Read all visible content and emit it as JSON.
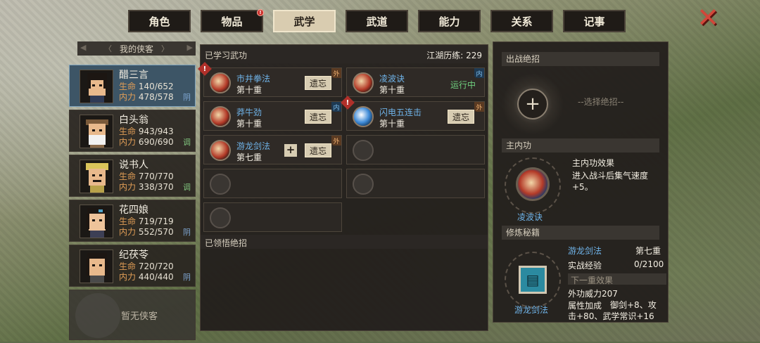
{
  "tabs": [
    {
      "label": "角色",
      "active": false,
      "badge": ""
    },
    {
      "label": "物品",
      "active": false,
      "badge": "!"
    },
    {
      "label": "武学",
      "active": true,
      "badge": ""
    },
    {
      "label": "武道",
      "active": false,
      "badge": ""
    },
    {
      "label": "能力",
      "active": false,
      "badge": ""
    },
    {
      "label": "关系",
      "active": false,
      "badge": ""
    },
    {
      "label": "记事",
      "active": false,
      "badge": ""
    }
  ],
  "close_icon": "close-x-icon",
  "heroes_header": "我的侠客",
  "stat_labels": {
    "hp": "生命",
    "mp": "内力"
  },
  "heroes": [
    {
      "name": "醋三言",
      "hp": "140/652",
      "mp": "478/578",
      "type": "阴",
      "active": true
    },
    {
      "name": "白头翁",
      "hp": "943/943",
      "mp": "690/690",
      "type": "调",
      "active": false
    },
    {
      "name": "说书人",
      "hp": "770/770",
      "mp": "338/370",
      "type": "调",
      "active": false
    },
    {
      "name": "花四娘",
      "hp": "719/719",
      "mp": "552/570",
      "type": "阴",
      "active": false
    },
    {
      "name": "纪茯苓",
      "hp": "720/720",
      "mp": "440/440",
      "type": "阴",
      "active": false
    }
  ],
  "empty_hero": "暂无侠客",
  "learned": {
    "title": "已学习武功",
    "exp_label": "江湖历练: 229",
    "forget_label": "遗忘",
    "running_label": "运行中",
    "skills": [
      {
        "name": "市井拳法",
        "level": "第十重",
        "corner": "外",
        "warn": true,
        "state": "forget",
        "icon": "fist-icon",
        "color": "red"
      },
      {
        "name": "凌波诀",
        "level": "第十重",
        "corner": "内",
        "warn": false,
        "state": "running",
        "icon": "wave-icon",
        "color": "red"
      },
      {
        "name": "莽牛劲",
        "level": "第十重",
        "corner": "内",
        "warn": false,
        "state": "forget",
        "icon": "bull-icon",
        "color": "red"
      },
      {
        "name": "闪电五连击",
        "level": "第十重",
        "corner": "外",
        "warn": true,
        "state": "forget",
        "icon": "lightning-icon",
        "color": "blue"
      },
      {
        "name": "游龙剑法",
        "level": "第七重",
        "corner": "外",
        "warn": false,
        "state": "forget",
        "icon": "sword-icon",
        "color": "red",
        "plus": true
      }
    ],
    "ult_title": "已领悟绝招"
  },
  "right": {
    "ult_header": "出战绝招",
    "ult_placeholder": "--选择绝招--",
    "internal_header": "主内功",
    "internal_name": "凌波诀",
    "internal_effect_title": "主内功效果",
    "internal_effect": "进入战斗后集气速度+5。",
    "training_header": "修炼秘籍",
    "book_name": "游龙剑法",
    "book_skill": "游龙剑法",
    "book_level": "第七重",
    "exp_label": "实战经验",
    "exp_value": "0/2100",
    "next_label": "下一重效果",
    "power_line": "外功威力207",
    "attr_label": "属性加成",
    "attr_value": "御剑+8、攻击+80、武学常识+16"
  }
}
